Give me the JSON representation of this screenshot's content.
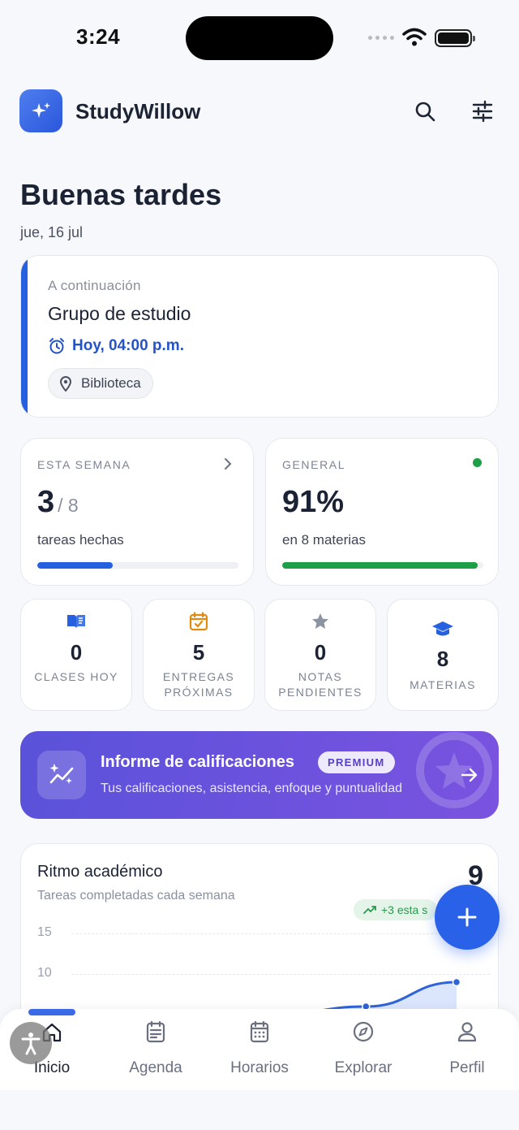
{
  "status_bar": {
    "time": "3:24"
  },
  "app": {
    "name": "StudyWillow"
  },
  "header": {
    "greeting": "Buenas tardes",
    "date": "jue, 16 jul"
  },
  "next_up": {
    "label": "A continuación",
    "title": "Grupo de estudio",
    "time": "Hoy, 04:00 p.m.",
    "location": "Biblioteca",
    "accent_color": "#2560e0"
  },
  "week": {
    "heading": "ESTA SEMANA",
    "done": "3",
    "total": "/ 8",
    "caption": "tareas hechas",
    "progress": 0.375,
    "bar_color": "#2560e0"
  },
  "general": {
    "heading": "GENERAL",
    "value": "91%",
    "caption": "en 8 materias",
    "progress": 0.97,
    "bar_color": "#1e9e46",
    "status_color": "#1e9e46"
  },
  "quick_stats": [
    {
      "value": "0",
      "label": "CLASES HOY",
      "icon": "book-open-icon",
      "color": "#2560e0"
    },
    {
      "value": "5",
      "label": "ENTREGAS PRÓXIMAS",
      "icon": "calendar-check-icon",
      "color": "#e08a12"
    },
    {
      "value": "0",
      "label": "NOTAS PENDIENTES",
      "icon": "star-icon",
      "color": "#8c93a3"
    },
    {
      "value": "8",
      "label": "MATERIAS",
      "icon": "graduation-cap-icon",
      "color": "#2560e0"
    }
  ],
  "premium": {
    "title": "Informe de calificaciones",
    "badge": "PREMIUM",
    "subtitle": "Tus calificaciones, asistencia, enfoque y puntualidad"
  },
  "pace": {
    "title": "Ritmo académico",
    "subtitle": "Tareas completadas cada semana",
    "total": "9",
    "trend": "+3 esta s"
  },
  "chart_data": {
    "type": "area",
    "title": "Ritmo académico",
    "subtitle": "Tareas completadas cada semana",
    "y_ticks": [
      "15",
      "10"
    ],
    "ylim": [
      0,
      15
    ],
    "series": [
      {
        "values": [
          4,
          4,
          5,
          6,
          9
        ]
      }
    ],
    "grid": true
  },
  "nav": [
    {
      "label": "Inicio",
      "icon": "home-icon",
      "active": true
    },
    {
      "label": "Agenda",
      "icon": "agenda-icon",
      "active": false
    },
    {
      "label": "Horarios",
      "icon": "calendar-grid-icon",
      "active": false
    },
    {
      "label": "Explorar",
      "icon": "compass-icon",
      "active": false
    },
    {
      "label": "Perfil",
      "icon": "user-icon",
      "active": false
    }
  ]
}
